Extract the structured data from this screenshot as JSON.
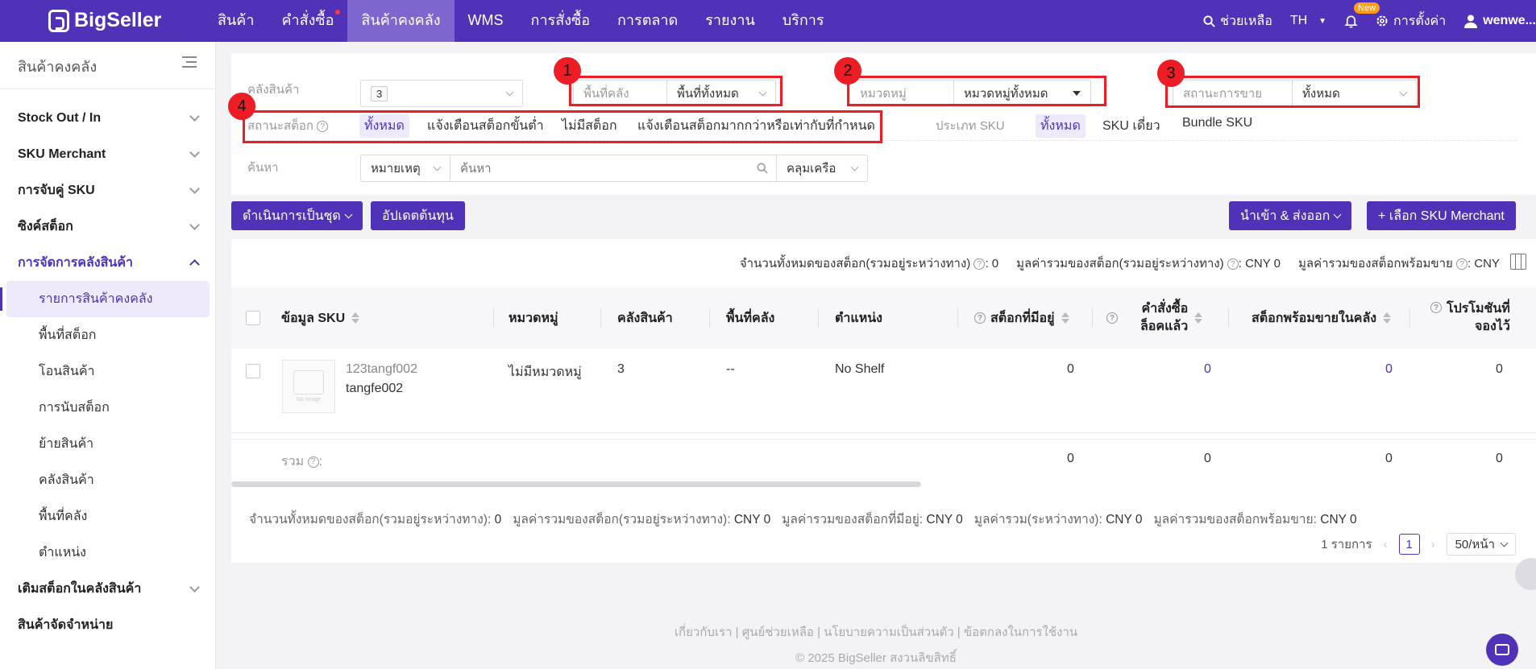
{
  "brand": "BigSeller",
  "nav": {
    "items": [
      "สินค้า",
      "คำสั่งซื้อ",
      "สินค้าคงคลัง",
      "WMS",
      "การสั่งซื้อ",
      "การตลาด",
      "รายงาน",
      "บริการ"
    ],
    "active": "สินค้าคงคลัง",
    "help": "ช่วยเหลือ",
    "lang": "TH",
    "new_badge": "New",
    "settings": "การตั้งค่า",
    "user": "wenwe..."
  },
  "sidebar": {
    "title": "สินค้าคงคลัง",
    "sections": [
      "Stock Out / In",
      "SKU Merchant",
      "การจับคู่ SKU",
      "ซิงค์สต็อก",
      "การจัดการคลังสินค้า"
    ],
    "subitems": [
      "รายการสินค้าคงคลัง",
      "พื้นที่สต็อก",
      "โอนสินค้า",
      "การนับสต็อก",
      "ย้ายสินค้า",
      "คลังสินค้า",
      "พื้นที่คลัง",
      "ตำแหน่ง"
    ],
    "bottom": [
      "เติมสต็อกในคลังสินค้า",
      "สินค้าจัดจำหน่าย"
    ]
  },
  "filters": {
    "warehouse_label": "คลังสินค้า",
    "warehouse_value": "3",
    "area_label": "พื้นที่คลัง",
    "area_value": "พื้นที่ทั้งหมด",
    "category_label": "หมวดหมู่",
    "category_value": "หมวดหมู่ทั้งหมด",
    "sale_status_label": "สถานะการขาย",
    "sale_status_value": "ทั้งหมด",
    "stock_status_label": "สถานะสต็อก",
    "stock_status_options": [
      "ทั้งหมด",
      "แจ้งเตือนสต็อกขั้นต่ำ",
      "ไม่มีสต็อก",
      "แจ้งเตือนสต็อกมากกว่าหรือเท่ากับที่กำหนด"
    ],
    "sku_type_label": "ประเภท SKU",
    "sku_type_options": [
      "ทั้งหมด",
      "SKU เดี่ยว",
      "Bundle SKU"
    ],
    "search_label": "ค้นหา",
    "search_field": "หมายเหตุ",
    "search_placeholder": "ค้นหา",
    "match_mode": "คลุมเครือ"
  },
  "annotations": [
    "1",
    "2",
    "3",
    "4"
  ],
  "actions": {
    "batch": "ดำเนินการเป็นชุด",
    "update_cost": "อัปเดตต้นทุน",
    "import_export": "นำเข้า & ส่งออก",
    "select_sku": "+ เลือก SKU Merchant"
  },
  "summary_top": {
    "total_stock": "จำนวนทั้งหมดของสต็อก(รวมอยู่ระหว่างทาง)",
    "total_stock_val": ": 0",
    "total_value": "มูลค่ารวมของสต็อก(รวมอยู่ระหว่างทาง)",
    "total_value_val": ": CNY 0",
    "sellable_value": "มูลค่ารวมของสต็อกพร้อมขาย",
    "sellable_value_val": ": CNY"
  },
  "table": {
    "headers": [
      "ข้อมูล SKU",
      "หมวดหมู่",
      "คลังสินค้า",
      "พื้นที่คลัง",
      "ตำแหน่ง",
      "สต็อกที่มีอยู่",
      "คำสั่งซื้อ",
      "ล็อคแล้ว",
      "สต็อกพร้อมขายในคลัง",
      "โปรโมชันที่",
      "จองไว้"
    ],
    "row": {
      "img_caption": "No Image",
      "sku": "123tangf002",
      "name": "tangfe002",
      "category": "ไม่มีหมวดหมู่",
      "warehouse": "3",
      "area": "--",
      "location": "No Shelf",
      "available": "0",
      "locked": "0",
      "sellable": "0",
      "promo": "0"
    },
    "total_label": "รวม",
    "totals": [
      "0",
      "0",
      "0",
      "0"
    ]
  },
  "footer_summary": [
    {
      "label": "จำนวนทั้งหมดของสต็อก(รวมอยู่ระหว่างทาง):",
      "value": "0"
    },
    {
      "label": "มูลค่ารวมของสต็อก(รวมอยู่ระหว่างทาง):",
      "value": "CNY 0"
    },
    {
      "label": "มูลค่ารวมของสต็อกที่มีอยู่:",
      "value": "CNY 0"
    },
    {
      "label": "มูลค่ารวม(ระหว่างทาง):",
      "value": "CNY 0"
    },
    {
      "label": "มูลค่ารวมของสต็อกพร้อมขาย:",
      "value": "CNY 0"
    }
  ],
  "pager": {
    "count": "1 รายการ",
    "page": "1",
    "size": "50/หน้า"
  },
  "footer_links": "เกี่ยวกับเรา | ศูนย์ช่วยเหลือ | นโยบายความเป็นส่วนตัว | ข้อตกลงในการใช้งาน",
  "copyright": "© 2025 BigSeller สงวนลิขสิทธิ์",
  "colors": {
    "primary": "#4f32b8",
    "annotation": "#ee1c25"
  }
}
